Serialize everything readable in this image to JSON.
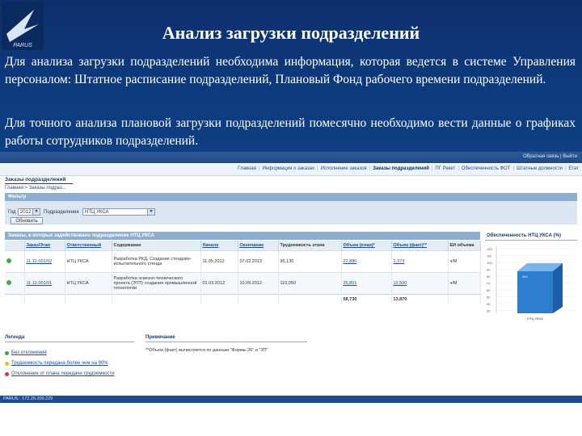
{
  "slide": {
    "title": "Анализ загрузки подразделений",
    "para1": "Для анализа загрузки подразделений необходима информация, которая ведется в системе Управления персоналом: Штатное расписание подразделений, Плановый Фонд рабочего времени подразделений.",
    "para2": "Для точного анализа плановой загрузки подразделений помесячно необходимо вести данные о графиках работы сотрудников подразделений.",
    "logo_text": "PARUS"
  },
  "app": {
    "top_links": "Обратная связь | Выйти",
    "nav": [
      "Главная",
      "Информация о заказах",
      "Исполнение заказов",
      "Заказы подразделений",
      "ПГ Ракет",
      "Обеспеченность ФОТ",
      "Штатные должности",
      "Етат"
    ],
    "active_nav": "Заказы подразделений",
    "page_title": "Заказы подразделений",
    "breadcrumbs": "Главная > Заказы подраз...",
    "filter": {
      "title": "Фильтр",
      "year_label": "Год",
      "year_value": "2012",
      "dept_label": "Подразделение",
      "dept_value": "НТЦ УКСА",
      "refresh_label": "Обновить"
    },
    "table": {
      "title": "Заказы, в которых задействовано подразделение НТЦ УКСА",
      "headers": [
        "",
        "Заказ/Этап",
        "Ответственный",
        "Содержание",
        "Начало",
        "Окончание",
        "Трудоемкость этапа",
        "Объем (план)*",
        "Объем (факт)**",
        "ЕИ объема"
      ],
      "rows": [
        {
          "order": "11.12.001/02",
          "resp": "НТЦ УКСА",
          "content": "Разработка РКД. Создание стендово-испытательного стенда",
          "start": "11.05.2012",
          "end": "07.02.2013",
          "labor": "96,130",
          "plan": "22,880",
          "fact": "1,373",
          "unit": "ч/М"
        },
        {
          "order": "11.12.001/01",
          "resp": "НТЦ УКСА",
          "content": "Разработка эскизно-технического проекта (ЭТП) создания промышленной технологии",
          "start": "01.03.2012",
          "end": "10.05.2012",
          "labor": "110,050",
          "plan": "25,851",
          "fact": "12,500",
          "unit": "ч/М"
        }
      ],
      "total_plan": "58,730",
      "total_fact": "13,870"
    },
    "chart_title": "Обеспеченность НТЦ УКСА (%)",
    "chart_axis": [
      "120",
      "110",
      "100",
      "90",
      "80",
      "70",
      "60",
      "50",
      "40",
      "30"
    ],
    "chart_bar_label": "НТЦ УКСА",
    "chart_bar_value_label": "1111",
    "legend_title": "Легенда",
    "legend_items": [
      {
        "text": "Без отклонений",
        "color": "#3fa63f"
      },
      {
        "text": "Трудоемкость передана более чем на 90%",
        "color": "#e8c21a"
      },
      {
        "text": "Отклонение от плана передачи трудоемкости",
        "color": "#d23a3a"
      }
    ],
    "note_title": "Примечание",
    "note_text": "**Объем (факт) вычисляется по данным \"Формы 26\" и \"ЗП\"",
    "status": "PARUS : 172.20.200.229"
  }
}
